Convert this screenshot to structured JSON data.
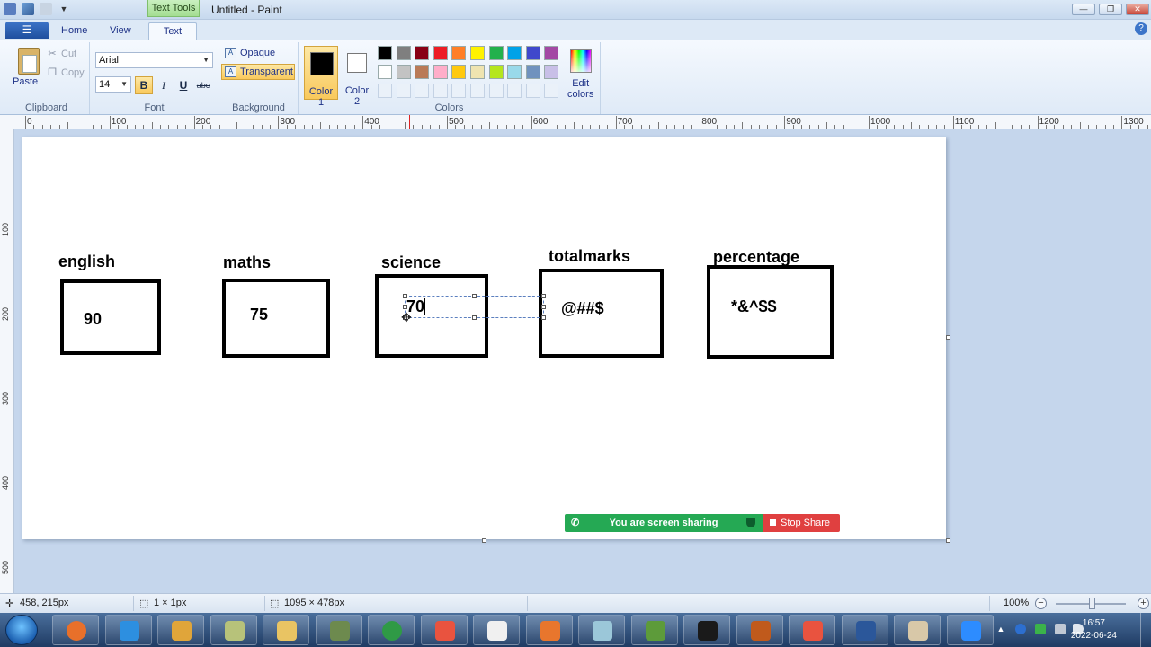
{
  "window": {
    "title": "Untitled - Paint",
    "contextual_tab": "Text Tools",
    "min": "—",
    "max": "❐",
    "close": "✕"
  },
  "ribbon_tabs": {
    "home": "Home",
    "view": "View",
    "text": "Text",
    "active": "Text"
  },
  "clipboard": {
    "paste": "Paste",
    "cut": "Cut",
    "copy": "Copy",
    "label": "Clipboard"
  },
  "font": {
    "family": "Arial",
    "size": "14",
    "bold": "B",
    "italic": "I",
    "underline": "U",
    "strike": "abc",
    "label": "Font",
    "bold_active": true
  },
  "background": {
    "opaque": "Opaque",
    "transparent": "Transparent",
    "label": "Background",
    "selected": "Transparent"
  },
  "colors": {
    "color1_label": "Color\n1",
    "color1_line1": "Color",
    "color1_line2": "1",
    "color2_line1": "Color",
    "color2_line2": "2",
    "color1": "#000000",
    "color2": "#ffffff",
    "edit_line1": "Edit",
    "edit_line2": "colors",
    "label": "Colors",
    "palette_row1": [
      "#000000",
      "#7f7f7f",
      "#880015",
      "#ed1c24",
      "#ff7f27",
      "#fff200",
      "#22b14c",
      "#00a2e8",
      "#3f48cc",
      "#a349a4"
    ],
    "palette_row2": [
      "#ffffff",
      "#c3c3c3",
      "#b97a57",
      "#ffaec9",
      "#ffc90e",
      "#efe4b0",
      "#b5e61d",
      "#99d9ea",
      "#7092be",
      "#c8bfe7"
    ]
  },
  "ruler": {
    "h_labels": [
      "0",
      "100",
      "200",
      "300",
      "400",
      "500",
      "600",
      "700",
      "800",
      "900",
      "1000",
      "1100",
      "1200",
      "1300"
    ],
    "v_labels": [
      "100",
      "200",
      "300",
      "400",
      "500"
    ]
  },
  "canvas": {
    "labels": {
      "english": "english",
      "maths": "maths",
      "science": "science",
      "totalmarks": "totalmarks",
      "percentage": "percentage"
    },
    "values": {
      "english": "90",
      "maths": "75",
      "science": "70",
      "totalmarks": "@##$",
      "percentage": "*&^$$"
    }
  },
  "share": {
    "status": "You are screen sharing",
    "stop": "Stop Share"
  },
  "status_bar": {
    "cursor_pos": "458, 215px",
    "selection_size": "1 × 1px",
    "canvas_size": "1095 × 478px",
    "zoom": "100%",
    "zoom_out": "−",
    "zoom_in": "+",
    "zoom_level_percent": 100
  },
  "taskbar": {
    "time": "16:57",
    "date": "2022-06-24",
    "apps": [
      "firefox",
      "internet-explorer",
      "media-player",
      "notes",
      "file-explorer",
      "tool-32",
      "chrome",
      "git",
      "xmind",
      "tool-orange",
      "eraser",
      "excel-chart",
      "command-prompt",
      "java-ide",
      "git-2",
      "word",
      "paint",
      "zoom"
    ]
  }
}
